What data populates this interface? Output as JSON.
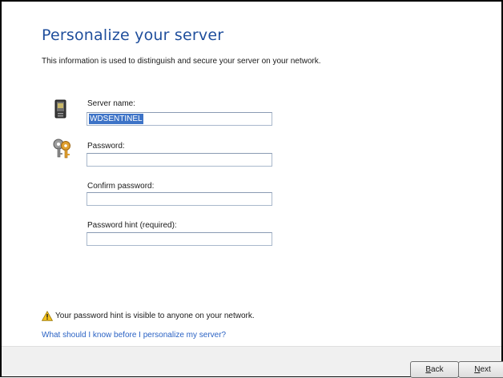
{
  "page": {
    "title": "Personalize your server",
    "description": "This information is used to distinguish and secure your server on your network."
  },
  "fields": {
    "server_name": {
      "label": "Server name:",
      "value": "WDSENTINEL"
    },
    "password": {
      "label": "Password:",
      "value": ""
    },
    "confirm_password": {
      "label": "Confirm password:",
      "value": ""
    },
    "password_hint": {
      "label": "Password hint (required):",
      "value": ""
    }
  },
  "warning": {
    "text": "Your password hint is visible to anyone on your network.",
    "icon": "warning-icon"
  },
  "help_link": "What should I know before I personalize my server?",
  "buttons": {
    "back": {
      "underlined": "B",
      "rest": "ack"
    },
    "next": {
      "underlined": "N",
      "rest": "ext"
    }
  },
  "colors": {
    "title": "#1f4e9c",
    "link": "#2a62c4",
    "selection": "#3d73c7"
  }
}
